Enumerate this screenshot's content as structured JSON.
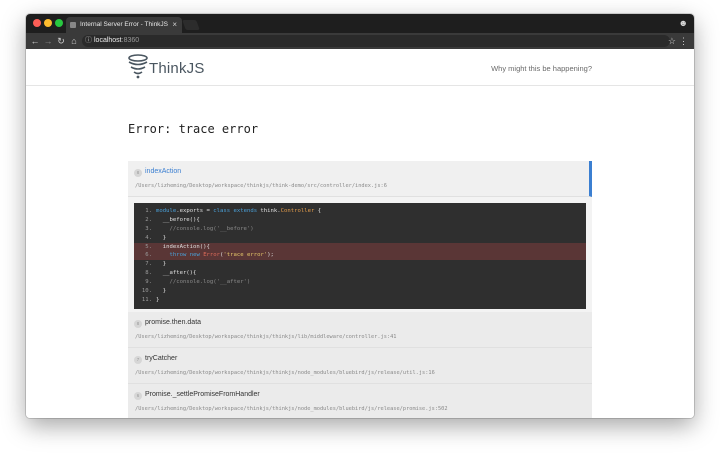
{
  "browser": {
    "tab_title": "Internal Server Error - ThinkJS",
    "tab_close": "×",
    "url_host": "localhost",
    "url_port": ":8360"
  },
  "header": {
    "logo_text": "ThinkJS",
    "help_link": "Why might this be happening?"
  },
  "error": {
    "title": "Error: trace error"
  },
  "frames": [
    {
      "num": "8",
      "func": "indexAction",
      "path": "/Users/lizheming/Desktop/workspace/thinkjs/think-demo/src/controller/index.js:6"
    },
    {
      "num": "8",
      "func": "promise.then.data",
      "path": "/Users/lizheming/Desktop/workspace/thinkjs/thinkjs/lib/middleware/controller.js:41"
    },
    {
      "num": "7",
      "func": "tryCatcher",
      "path": "/Users/lizheming/Desktop/workspace/thinkjs/thinkjs/node_modules/bluebird/js/release/util.js:16"
    },
    {
      "num": "6",
      "func": "Promise._settlePromiseFromHandler",
      "path": "/Users/lizheming/Desktop/workspace/thinkjs/thinkjs/node_modules/bluebird/js/release/promise.js:502"
    }
  ],
  "code": {
    "lines": [
      "1.",
      "2.",
      "3.",
      "4.",
      "5.",
      "6.",
      "7.",
      "8.",
      "9.",
      "10.",
      "11."
    ],
    "highlighted": [
      "5",
      "6"
    ]
  }
}
